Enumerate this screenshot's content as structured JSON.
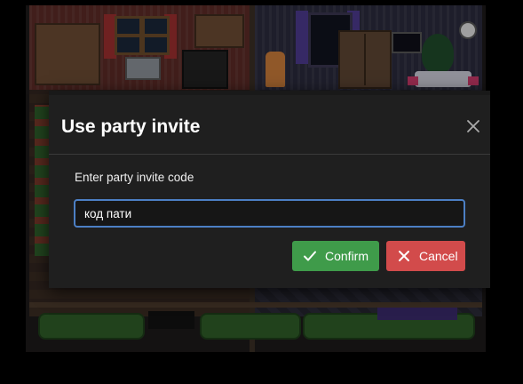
{
  "modal": {
    "title": "Use party invite",
    "field_label": "Enter party invite code",
    "input_value": "код пати",
    "input_placeholder": "",
    "confirm_label": "Confirm",
    "cancel_label": "Cancel",
    "icons": {
      "close": "close-icon",
      "confirm": "checkmark-icon",
      "cancel": "x-icon"
    }
  },
  "colors": {
    "confirm": "#3f9b4a",
    "cancel": "#d24b4b",
    "input_focus_border": "#4c7fc4",
    "modal_bg": "#1f1f1f"
  }
}
